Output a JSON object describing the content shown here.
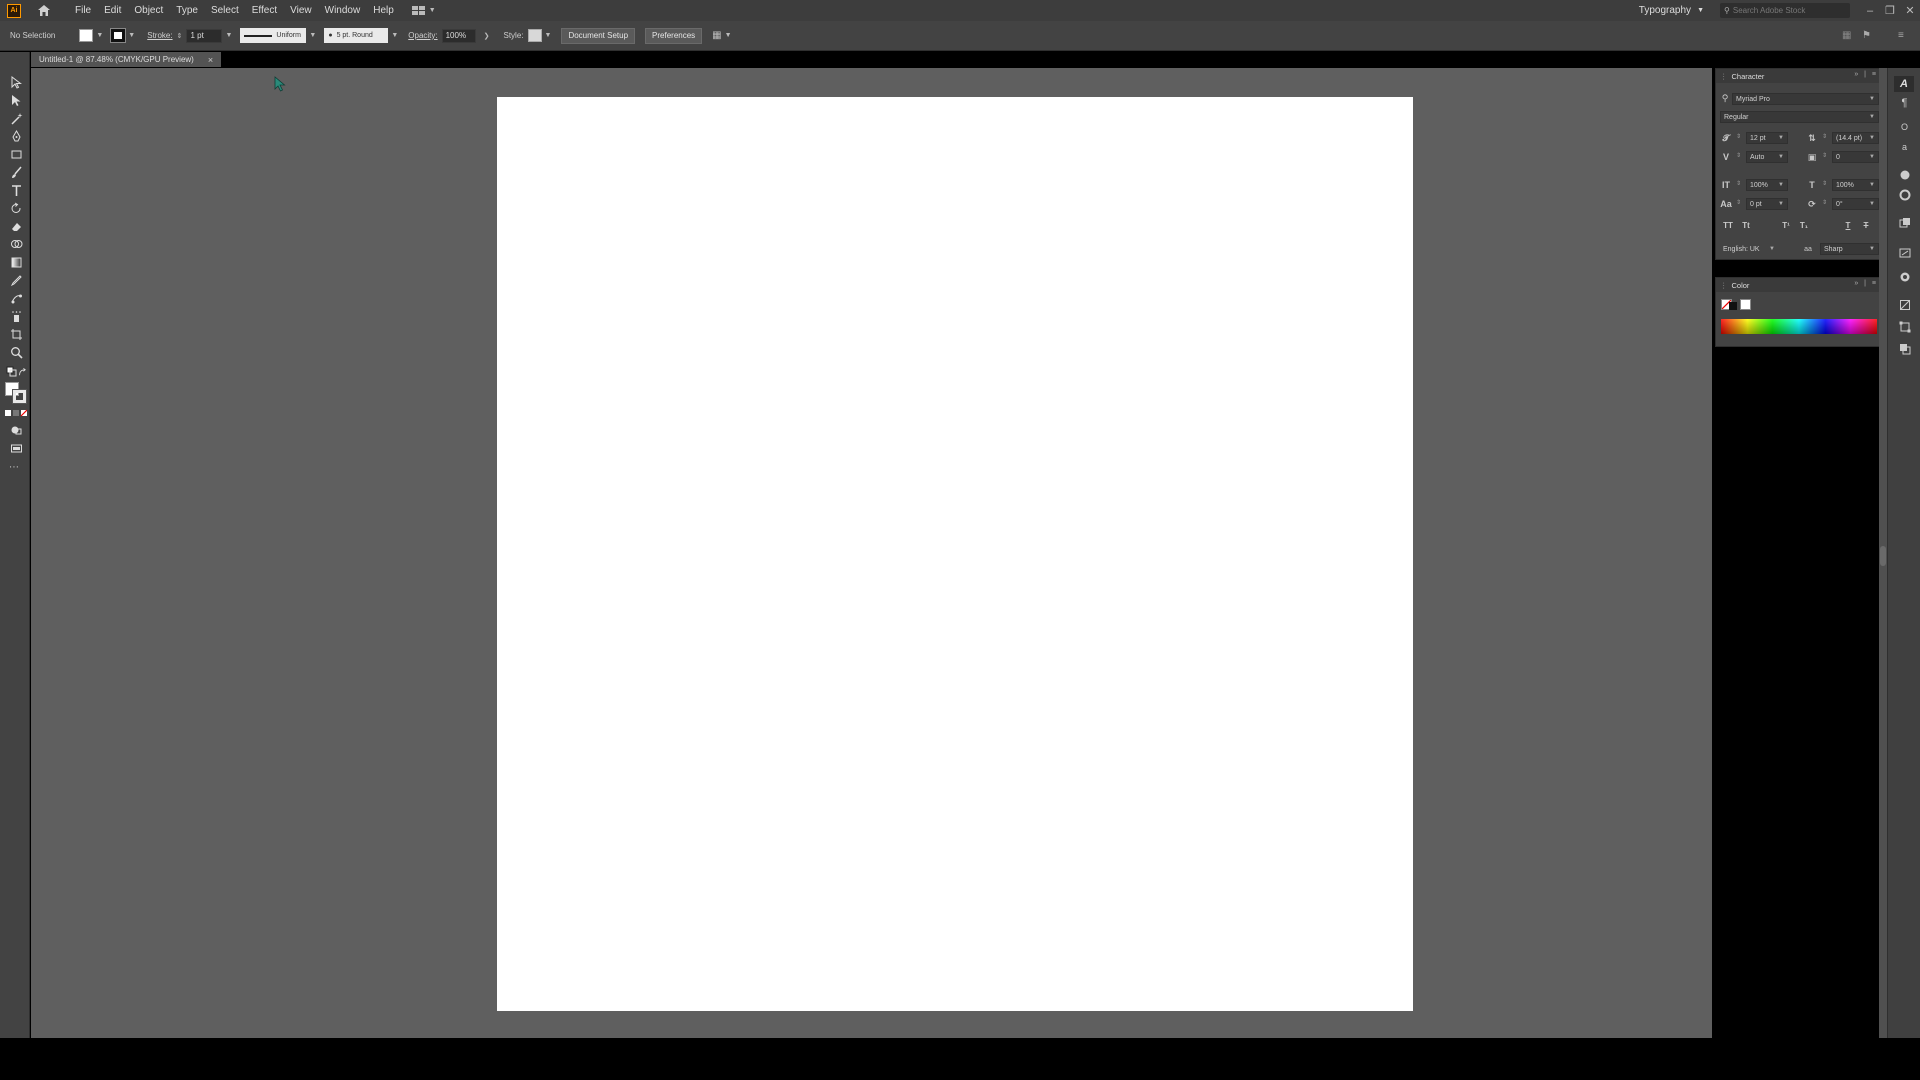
{
  "app": {
    "logo_text": "Ai",
    "menus": [
      "File",
      "Edit",
      "Object",
      "Type",
      "Select",
      "Effect",
      "View",
      "Window",
      "Help"
    ],
    "workspace": "Typography",
    "search_placeholder": "Search Adobe Stock"
  },
  "control_bar": {
    "selection_label": "No Selection",
    "stroke_label": "Stroke:",
    "stroke_weight": "1 pt",
    "variable_width": "Uniform",
    "brush": "5 pt. Round",
    "opacity_label": "Opacity:",
    "opacity_value": "100%",
    "style_label": "Style:",
    "document_setup": "Document Setup",
    "preferences": "Preferences"
  },
  "document": {
    "tab_title": "Untitled-1 @ 87.48% (CMYK/GPU Preview)",
    "close": "×"
  },
  "character_panel": {
    "title": "Character",
    "font_family": "Myriad Pro",
    "font_style": "Regular",
    "font_size": "12 pt",
    "leading": "(14.4 pt)",
    "kerning": "Auto",
    "tracking": "0",
    "vertical_scale": "100%",
    "horizontal_scale": "100%",
    "baseline_shift": "0 pt",
    "rotation": "0°",
    "language": "English: UK",
    "anti_alias_label": "aa",
    "anti_alias": "Sharp"
  },
  "color_panel": {
    "title": "Color"
  },
  "colors": {
    "menubar": "#3d3d3d",
    "panel": "#434343",
    "canvas": "#5f5f5f",
    "artboard": "#ffffff"
  }
}
